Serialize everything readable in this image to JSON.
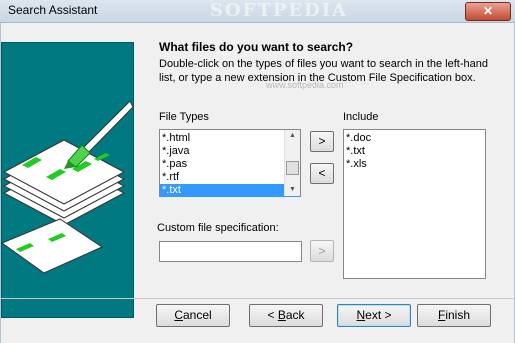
{
  "window": {
    "title": "Search Assistant",
    "watermark": "SOFTPEDIA",
    "close_glyph": "✕"
  },
  "main": {
    "heading": "What files do you want to search?",
    "description": "Double-click on the types of files you want to search in the left-hand list, or type a new extension in the Custom File Specification box.",
    "sub_watermark": "www.softpedia.com"
  },
  "file_types": {
    "label": "File Types",
    "items": [
      "*.html",
      "*.java",
      "*.pas",
      "*.rtf",
      "*.txt"
    ],
    "selected_index": 4
  },
  "include": {
    "label": "Include",
    "items": [
      "*.doc",
      "*.txt",
      "*.xls"
    ]
  },
  "move_buttons": {
    "add": ">",
    "remove": "<",
    "add_custom": ">"
  },
  "custom": {
    "label": "Custom file specification:",
    "value": ""
  },
  "footer": {
    "cancel": "Cancel",
    "back_prefix": "< ",
    "back_key": "B",
    "back_rest": "ack",
    "next_key": "N",
    "next_rest": "ext >",
    "finish_key": "F",
    "finish_rest": "inish",
    "cancel_key": "C",
    "cancel_rest": "ancel"
  },
  "colors": {
    "illustration_bg": "#007a80",
    "selection": "#3399ff"
  }
}
